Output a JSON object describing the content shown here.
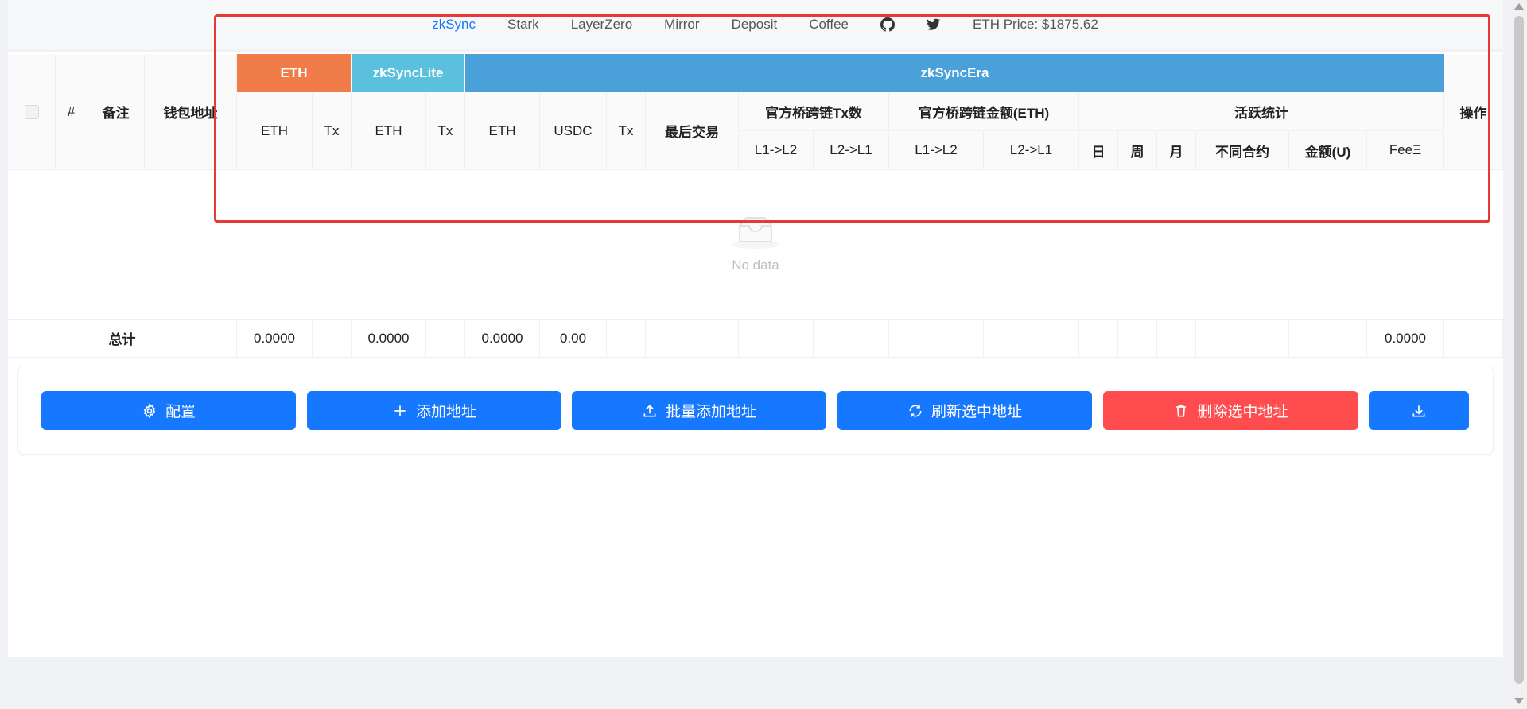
{
  "nav": {
    "links": [
      "zkSync",
      "Stark",
      "LayerZero",
      "Mirror",
      "Deposit",
      "Coffee"
    ],
    "active": "zkSync",
    "github_icon": "github-icon",
    "twitter_icon": "twitter-icon",
    "eth_price": "ETH Price: $1875.62"
  },
  "table": {
    "fixed_headers": {
      "index": "#",
      "note": "备注",
      "address": "钱包地址",
      "action": "操作"
    },
    "groups": {
      "eth": "ETH",
      "lite": "zkSyncLite",
      "era": "zkSyncEra"
    },
    "eth_cols": [
      "ETH",
      "Tx"
    ],
    "lite_cols": [
      "ETH",
      "Tx"
    ],
    "era_cols": [
      "ETH",
      "USDC",
      "Tx",
      "最后交易"
    ],
    "bridge_tx": {
      "title": "官方桥跨链Tx数",
      "cols": [
        "L1->L2",
        "L2->L1"
      ]
    },
    "bridge_amt": {
      "title": "官方桥跨链金额(ETH)",
      "cols": [
        "L1->L2",
        "L2->L1"
      ]
    },
    "activity": {
      "title": "活跃统计",
      "cols": [
        "日",
        "周",
        "月",
        "不同合约",
        "金额(U)",
        "FeeΞ"
      ]
    },
    "empty_text": "No data",
    "totals": {
      "label": "总计",
      "eth_eth": "0.0000",
      "lite_eth": "0.0000",
      "era_eth": "0.0000",
      "era_usdc": "0.00",
      "fee": "0.0000"
    }
  },
  "actions": {
    "config": "配置",
    "add": "添加地址",
    "batch_add": "批量添加地址",
    "refresh": "刷新选中地址",
    "delete": "删除选中地址"
  },
  "colors": {
    "eth_group": "#f07c4a",
    "lite_group": "#5bc0de",
    "era_group": "#4aa0d8",
    "primary": "#1677ff",
    "danger": "#ff4d4f",
    "highlight": "#e53935"
  }
}
